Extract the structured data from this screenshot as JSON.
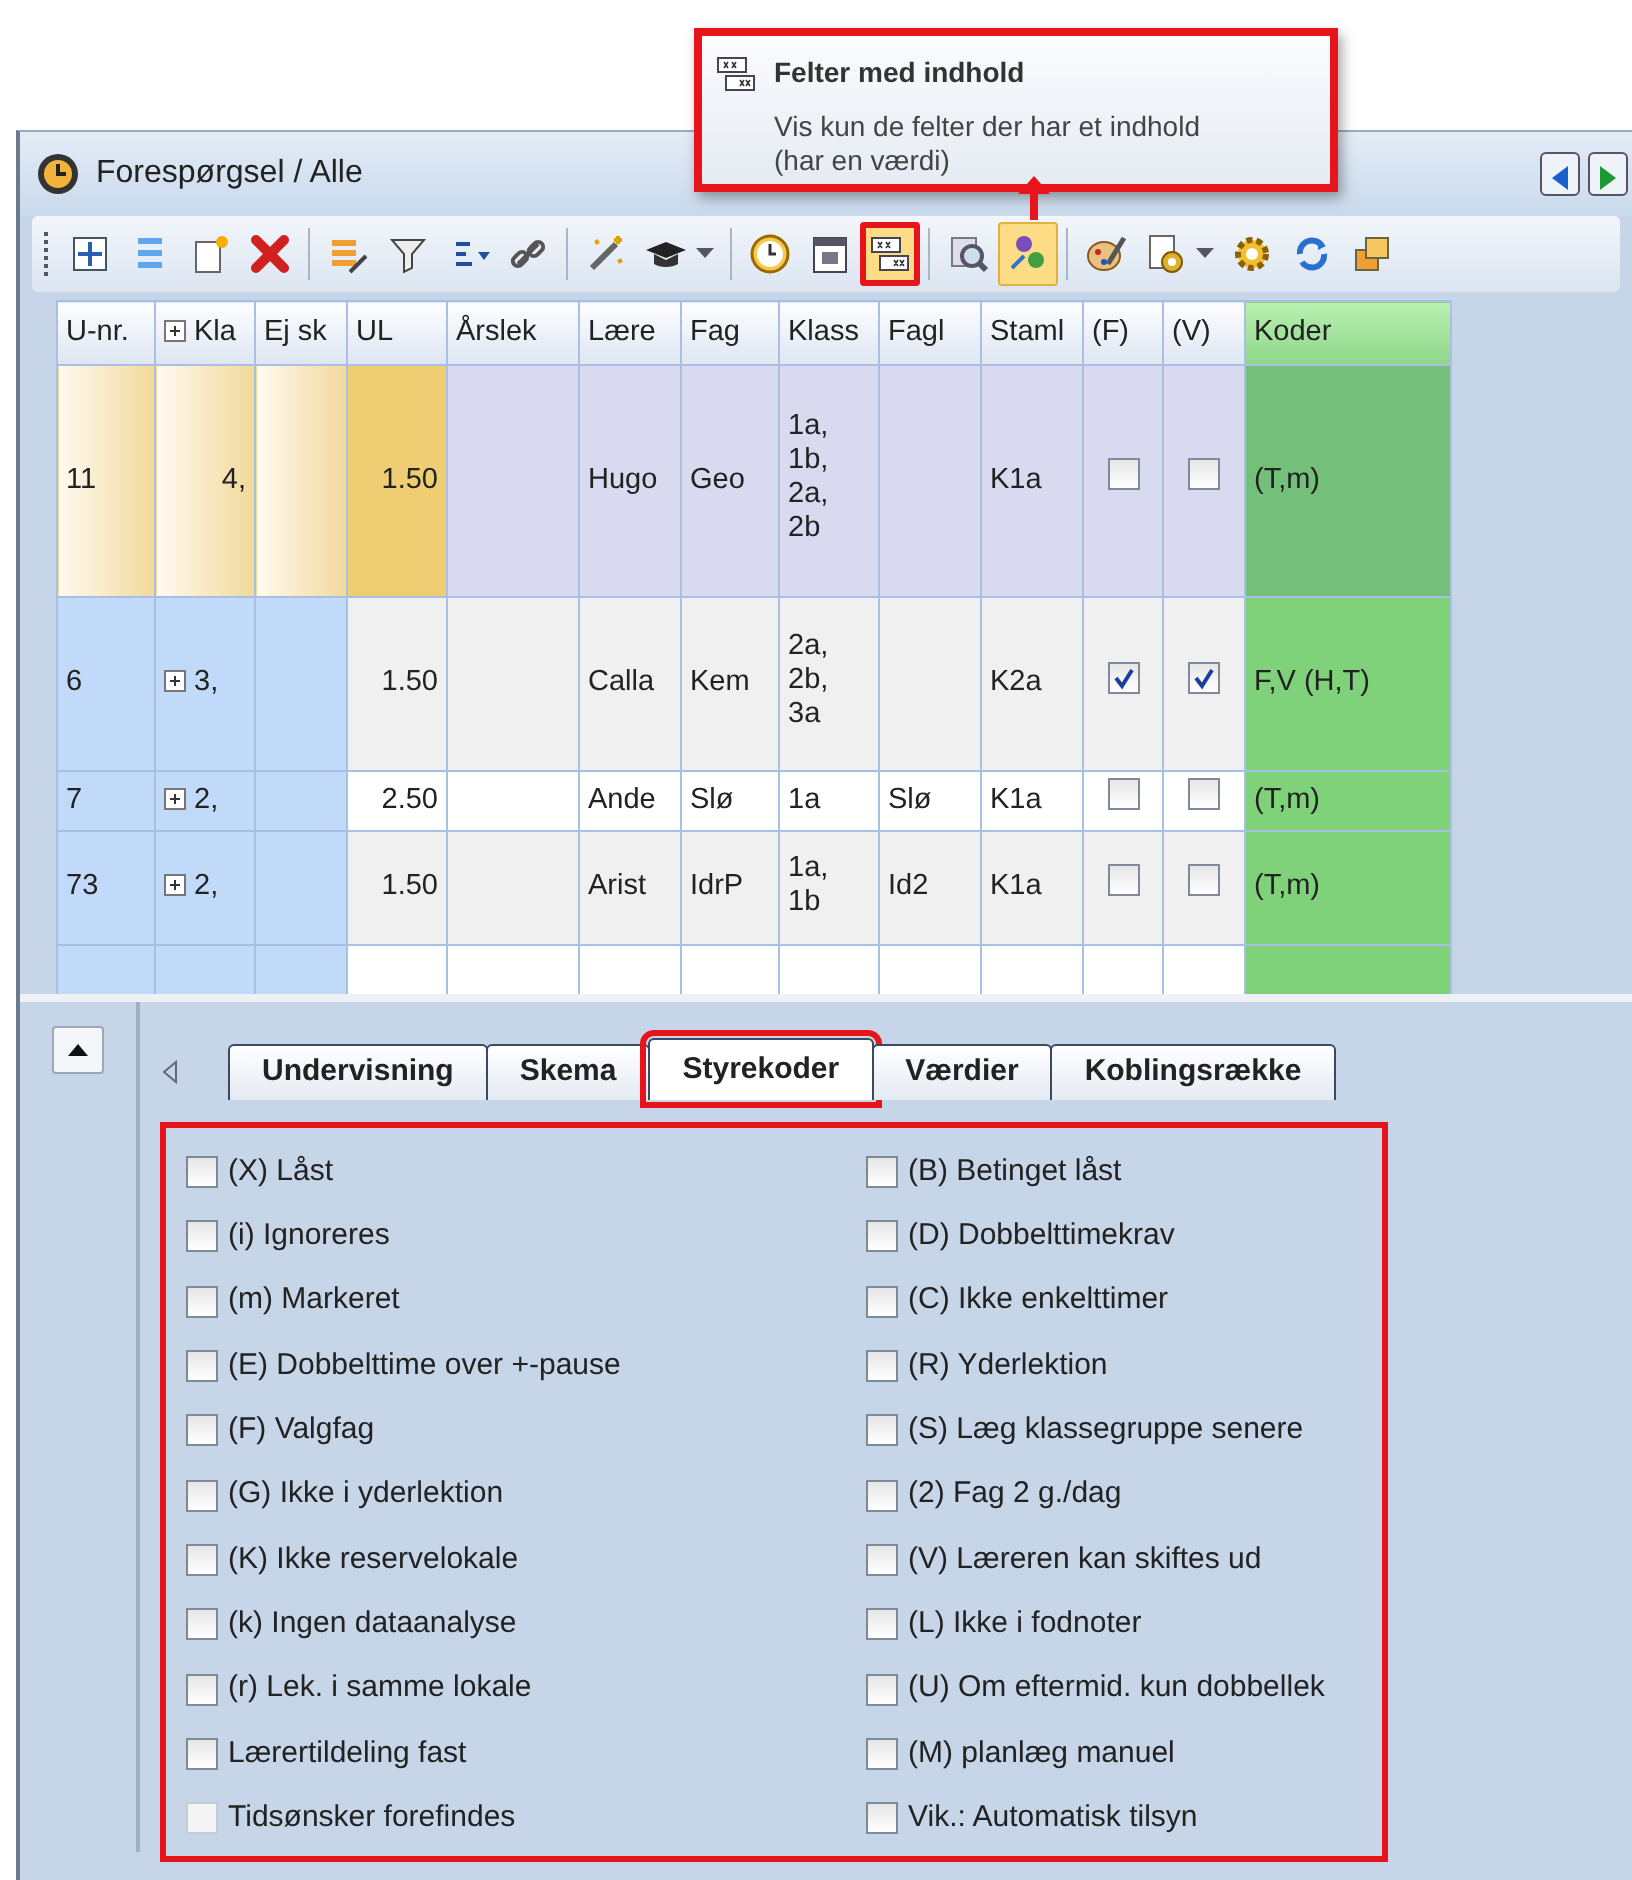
{
  "tooltip": {
    "title": "Felter med indhold",
    "lines": [
      "Vis kun de felter der har et indhold",
      "(har en værdi)"
    ]
  },
  "window": {
    "title": "Forespørgsel / Alle"
  },
  "toolbar": [
    {
      "kind": "grip"
    },
    {
      "kind": "move",
      "selected": false,
      "outlined": false
    },
    {
      "kind": "list",
      "selected": false,
      "outlined": false
    },
    {
      "kind": "newpage",
      "selected": false,
      "outlined": false
    },
    {
      "kind": "delete",
      "selected": false,
      "outlined": false
    },
    {
      "kind": "sep"
    },
    {
      "kind": "editlist",
      "selected": false,
      "outlined": false
    },
    {
      "kind": "filter",
      "selected": false,
      "outlined": false
    },
    {
      "kind": "sort",
      "selected": false,
      "outlined": false
    },
    {
      "kind": "link",
      "selected": false,
      "outlined": false
    },
    {
      "kind": "sep"
    },
    {
      "kind": "wand",
      "selected": false,
      "outlined": false
    },
    {
      "kind": "cap",
      "selected": false,
      "outlined": false
    },
    {
      "kind": "caret"
    },
    {
      "kind": "sep"
    },
    {
      "kind": "clock",
      "selected": false,
      "outlined": false
    },
    {
      "kind": "calendar",
      "selected": false,
      "outlined": false
    },
    {
      "kind": "fields",
      "selected": true,
      "outlined": true
    },
    {
      "kind": "sep"
    },
    {
      "kind": "search",
      "selected": false,
      "outlined": false
    },
    {
      "kind": "people",
      "selected": true,
      "outlined": false
    },
    {
      "kind": "sep"
    },
    {
      "kind": "palette",
      "selected": false,
      "outlined": false
    },
    {
      "kind": "pagegear",
      "selected": false,
      "outlined": false
    },
    {
      "kind": "caret"
    },
    {
      "kind": "gear",
      "selected": false,
      "outlined": false
    },
    {
      "kind": "refresh",
      "selected": false,
      "outlined": false
    },
    {
      "kind": "windows",
      "selected": false,
      "outlined": false
    }
  ],
  "table": {
    "columns": [
      {
        "label": "U-nr.",
        "kind": "key",
        "expandable": false
      },
      {
        "label": "Kla",
        "kind": "key",
        "expandable": true
      },
      {
        "label": "Ej sk",
        "kind": "key",
        "expandable": false
      },
      {
        "label": "UL",
        "kind": "ul",
        "expandable": false
      },
      {
        "label": "Årslek",
        "kind": "plain",
        "expandable": false
      },
      {
        "label": "Lære",
        "kind": "plain",
        "expandable": false
      },
      {
        "label": "Fag",
        "kind": "plain",
        "expandable": false
      },
      {
        "label": "Klass",
        "kind": "plain",
        "expandable": false
      },
      {
        "label": "Fagl",
        "kind": "plain",
        "expandable": false
      },
      {
        "label": "Staml",
        "kind": "plain",
        "expandable": false
      },
      {
        "label": "(F)",
        "kind": "check",
        "expandable": false
      },
      {
        "label": "(V)",
        "kind": "check",
        "expandable": false
      },
      {
        "label": "Koder",
        "kind": "codes",
        "expandable": false
      }
    ],
    "rows": [
      {
        "selected": true,
        "cells": [
          {
            "text": "11"
          },
          {
            "text": "4,",
            "expandable": false
          },
          {},
          {
            "text": "1.50"
          },
          {},
          {
            "text": "Hugo"
          },
          {
            "text": "Geo"
          },
          {
            "text": "1a,\n1b,\n2a,\n2b"
          },
          {},
          {
            "text": "K1a"
          },
          {
            "checked": false
          },
          {
            "checked": false
          },
          {
            "text": "(T,m)"
          }
        ]
      },
      {
        "selected": false,
        "cells": [
          {
            "text": "6"
          },
          {
            "text": "3,",
            "expandable": true
          },
          {},
          {
            "text": "1.50"
          },
          {},
          {
            "text": "Calla"
          },
          {
            "text": "Kem"
          },
          {
            "text": "2a,\n2b,\n3a"
          },
          {},
          {
            "text": "K2a"
          },
          {
            "checked": true
          },
          {
            "checked": true
          },
          {
            "text": "F,V (H,T)"
          }
        ]
      },
      {
        "selected": false,
        "cells": [
          {
            "text": "7"
          },
          {
            "text": "2,",
            "expandable": true
          },
          {},
          {
            "text": "2.50"
          },
          {},
          {
            "text": "Ande"
          },
          {
            "text": "Slø"
          },
          {
            "text": "1a"
          },
          {
            "text": "Slø"
          },
          {
            "text": "K1a"
          },
          {
            "checked": false
          },
          {
            "checked": false
          },
          {
            "text": "(T,m)"
          }
        ]
      },
      {
        "selected": false,
        "cells": [
          {
            "text": "73"
          },
          {
            "text": "2,",
            "expandable": true
          },
          {},
          {
            "text": "1.50"
          },
          {},
          {
            "text": "Arist"
          },
          {
            "text": "IdrP"
          },
          {
            "text": "1a,\n1b"
          },
          {
            "text": "Id2"
          },
          {
            "text": "K1a"
          },
          {
            "checked": false
          },
          {
            "checked": false
          },
          {
            "text": "(T,m)"
          }
        ]
      }
    ]
  },
  "tabs": [
    {
      "label": "Undervisning",
      "selected": false,
      "outlined": false
    },
    {
      "label": "Skema",
      "selected": false,
      "outlined": false
    },
    {
      "label": "Styrekoder",
      "selected": true,
      "outlined": true
    },
    {
      "label": "Værdier",
      "selected": false,
      "outlined": false
    },
    {
      "label": "Koblingsrække",
      "selected": false,
      "outlined": false
    }
  ],
  "options": [
    {
      "label": "(X) Låst",
      "checked": false,
      "disabled": false
    },
    {
      "label": "(B) Betinget låst",
      "checked": false,
      "disabled": false
    },
    {
      "label": "(i) Ignoreres",
      "checked": false,
      "disabled": false
    },
    {
      "label": "(D) Dobbelttimekrav",
      "checked": false,
      "disabled": false
    },
    {
      "label": "(m) Markeret",
      "checked": false,
      "disabled": false
    },
    {
      "label": "(C) Ikke enkelttimer",
      "checked": false,
      "disabled": false
    },
    {
      "label": "(E) Dobbelttime over +-pause",
      "checked": false,
      "disabled": false
    },
    {
      "label": "(R) Yderlektion",
      "checked": false,
      "disabled": false
    },
    {
      "label": "(F) Valgfag",
      "checked": false,
      "disabled": false
    },
    {
      "label": "(S) Læg klassegruppe senere",
      "checked": false,
      "disabled": false
    },
    {
      "label": "(G) Ikke i yderlektion",
      "checked": false,
      "disabled": false
    },
    {
      "label": "(2) Fag 2 g./dag",
      "checked": false,
      "disabled": false
    },
    {
      "label": "(K) Ikke reservelokale",
      "checked": false,
      "disabled": false
    },
    {
      "label": "(V) Læreren kan skiftes ud",
      "checked": false,
      "disabled": false
    },
    {
      "label": "(k) Ingen dataanalyse",
      "checked": false,
      "disabled": false
    },
    {
      "label": "(L) Ikke i fodnoter",
      "checked": false,
      "disabled": false
    },
    {
      "label": "(r) Lek. i samme lokale",
      "checked": false,
      "disabled": false
    },
    {
      "label": "(U) Om eftermid. kun dobbellek",
      "checked": false,
      "disabled": false
    },
    {
      "label": "Lærertildeling fast",
      "checked": false,
      "disabled": false
    },
    {
      "label": "(M) planlæg manuel",
      "checked": false,
      "disabled": false
    },
    {
      "label": "Tidsønsker forefindes",
      "checked": false,
      "disabled": true
    },
    {
      "label": "Vik.: Automatisk tilsyn",
      "checked": false,
      "disabled": false
    }
  ]
}
